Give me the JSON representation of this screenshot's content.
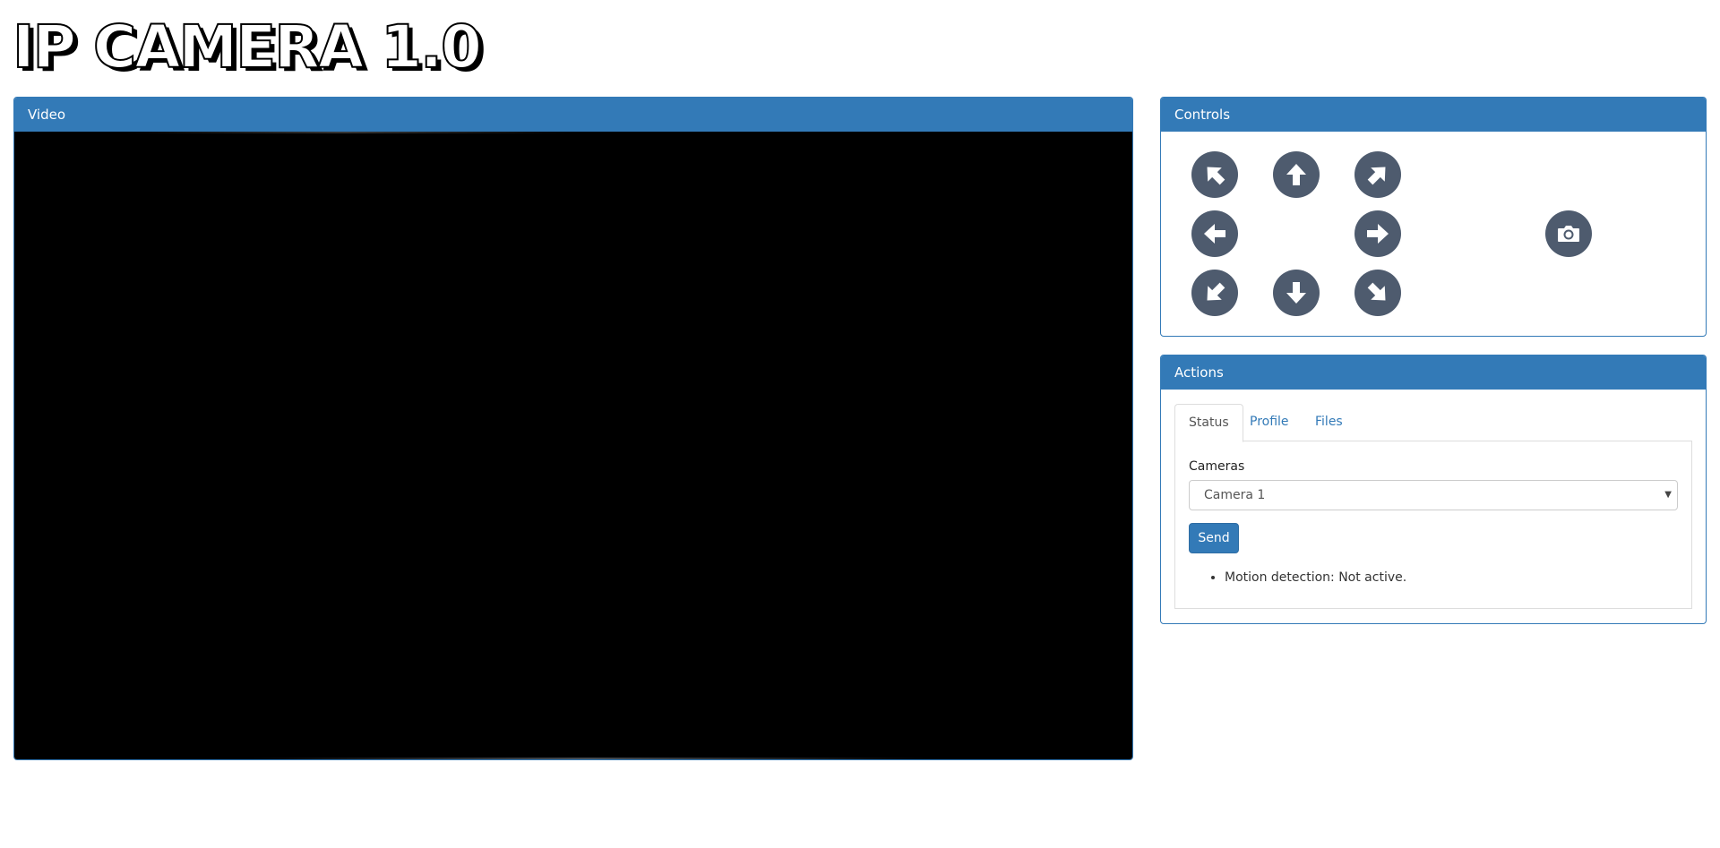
{
  "app": {
    "title": "IP CAMERA 1.0"
  },
  "video_panel": {
    "heading": "Video"
  },
  "controls_panel": {
    "heading": "Controls",
    "buttons": [
      {
        "name": "move-up-left",
        "icon": "arrow-up-left-icon"
      },
      {
        "name": "move-up",
        "icon": "arrow-up-icon"
      },
      {
        "name": "move-up-right",
        "icon": "arrow-up-right-icon"
      },
      {
        "name": "move-left",
        "icon": "arrow-left-icon"
      },
      {
        "name": "move-right",
        "icon": "arrow-right-icon"
      },
      {
        "name": "snapshot",
        "icon": "camera-icon"
      },
      {
        "name": "move-down-left",
        "icon": "arrow-down-left-icon"
      },
      {
        "name": "move-down",
        "icon": "arrow-down-icon"
      },
      {
        "name": "move-down-right",
        "icon": "arrow-down-right-icon"
      }
    ]
  },
  "actions_panel": {
    "heading": "Actions",
    "tabs": [
      {
        "label": "Status",
        "active": true
      },
      {
        "label": "Profile",
        "active": false
      },
      {
        "label": "Files",
        "active": false
      }
    ],
    "cameras_label": "Cameras",
    "camera_select": {
      "selected": "Camera 1"
    },
    "send_label": "Send",
    "status_items": [
      "Motion detection: Not active."
    ]
  },
  "colors": {
    "primary": "#337ab7",
    "control_button": "#4e5b6e",
    "video_background": "#000000"
  }
}
